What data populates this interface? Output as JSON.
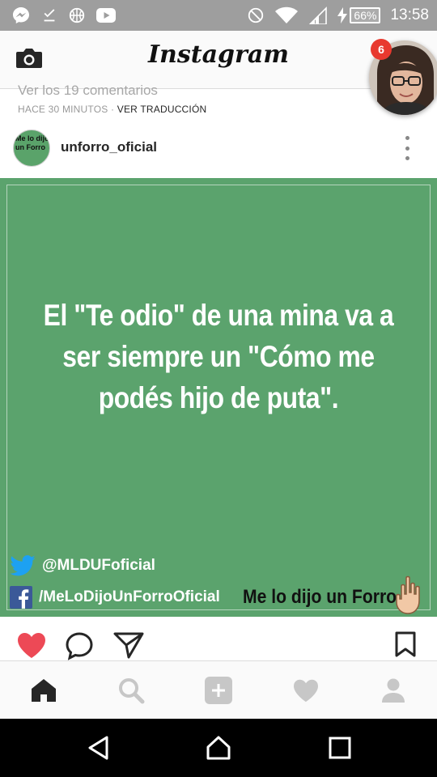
{
  "status_bar": {
    "battery": "66%",
    "time": "13:58"
  },
  "header": {
    "logo": "Instagram",
    "story_badge_count": "6"
  },
  "feed": {
    "previous_comments": "Ver los 19 comentarios",
    "timestamp": "HACE 30 MINUTOS",
    "separator": "·",
    "translate_label": "VER TRADUCCIÓN"
  },
  "post": {
    "username": "unforro_oficial",
    "avatar_text": "Me lo dijo un Forro",
    "image": {
      "background_color": "#5ba36d",
      "quote_line_1": "El \"Te odio\" de una mina va a",
      "quote_line_2": "ser siempre un \"Cómo me",
      "quote_line_3": "podés hijo de puta\".",
      "twitter_handle": "@MLDUFoficial",
      "facebook_page": "/MeLoDijoUnForroOficial",
      "brand": "Me lo dijo un Forro"
    }
  },
  "actions": {
    "like_color": "#ed4956",
    "icons": [
      "heart-icon",
      "comment-icon",
      "share-icon",
      "bookmark-icon"
    ]
  },
  "tabs": [
    "home-icon",
    "search-icon",
    "add-icon",
    "activity-icon",
    "profile-icon"
  ]
}
